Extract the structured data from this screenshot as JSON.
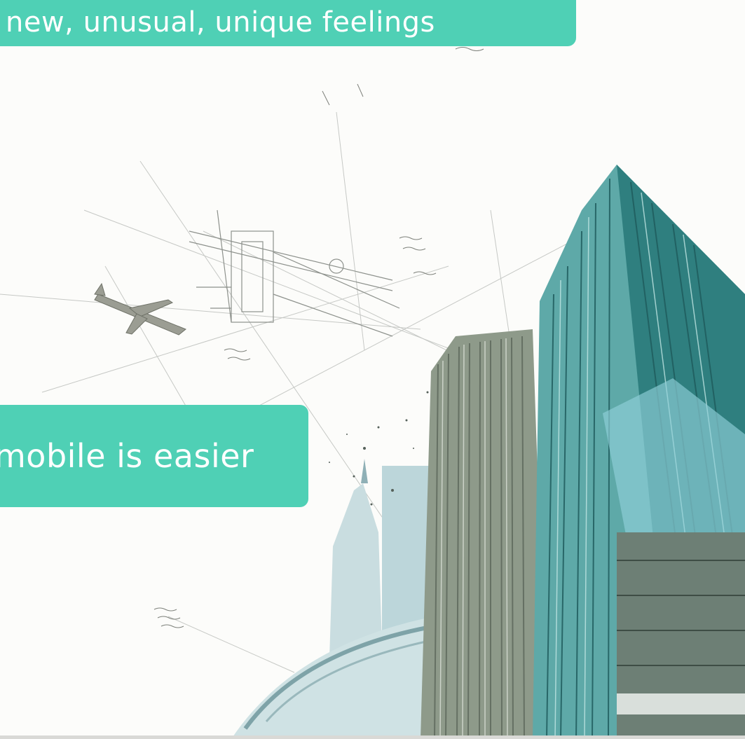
{
  "slides": {
    "headline_top": "new, unusual, unique feelings",
    "headline_mid": "mobile is easier"
  },
  "scene": {
    "illustration": "architectural-sketch-skyscrapers-with-airplane",
    "accent_color": "#4fd0b5",
    "sketch_color": "#8a8f8a",
    "glass_colors": [
      "#2f8c8a",
      "#6fbcc0",
      "#a7d6db",
      "#3e6b6e",
      "#7c8a72"
    ]
  }
}
